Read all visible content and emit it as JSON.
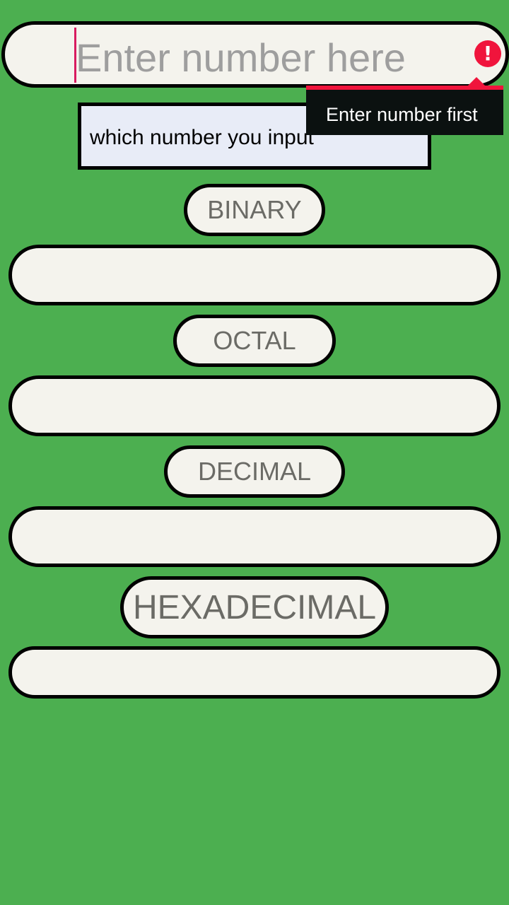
{
  "main_input": {
    "placeholder": "Enter number here"
  },
  "error": {
    "icon": "error-icon",
    "tooltip": "Enter number first",
    "color": "#f0143c"
  },
  "info_label": "which number you input",
  "buttons": {
    "binary": "BINARY",
    "octal": "OCTAL",
    "decimal": "DECIMAL",
    "hexadecimal": "HEXADECIMAL"
  },
  "outputs": {
    "binary": "",
    "octal": "",
    "decimal": "",
    "hexadecimal": ""
  },
  "colors": {
    "background": "#4caf50",
    "field": "#f4f3ed",
    "info_box": "#e8ecf7",
    "cursor": "#d81b60"
  }
}
